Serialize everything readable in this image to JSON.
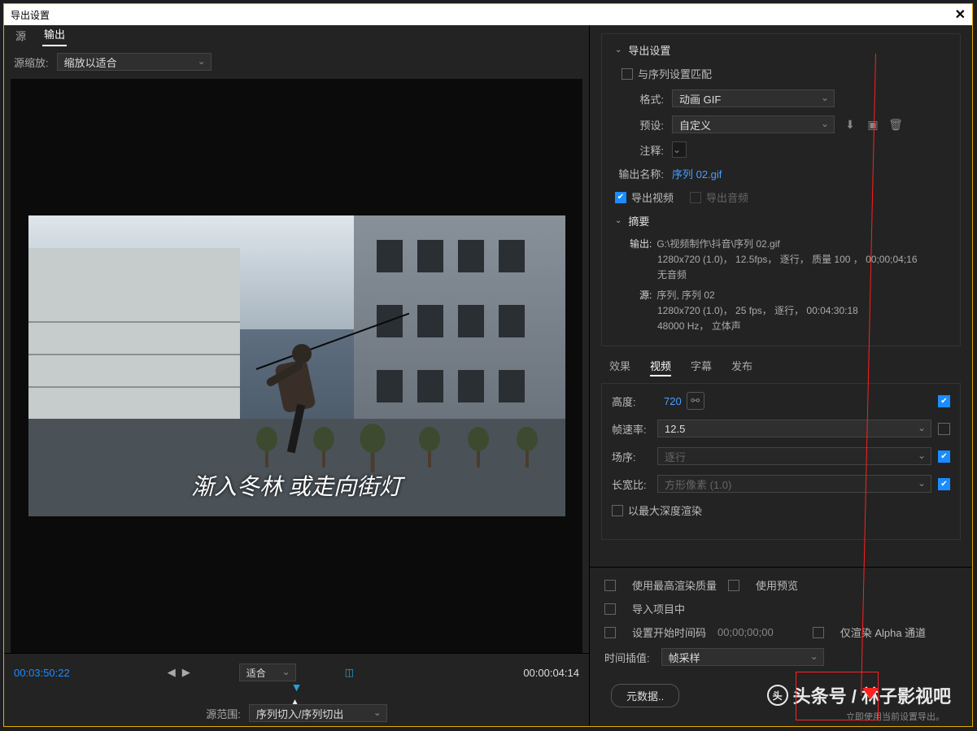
{
  "title": "导出设置",
  "left": {
    "tabs": {
      "source": "源",
      "output": "输出"
    },
    "scale_label": "源缩放:",
    "scale_value": "缩放以适合",
    "subtitle": "渐入冬林  或走向街灯",
    "tc_left": "00:03:50:22",
    "fit": "适合",
    "tc_right": "00:00:04:14",
    "range_label": "源范围:",
    "range_value": "序列切入/序列切出"
  },
  "export": {
    "header": "导出设置",
    "match_label": "与序列设置匹配",
    "format_label": "格式:",
    "format_value": "动画 GIF",
    "preset_label": "预设:",
    "preset_value": "自定义",
    "comment_label": "注释:",
    "outname_label": "输出名称:",
    "outname_value": "序列 02.gif",
    "export_video": "导出视频",
    "export_audio": "导出音频"
  },
  "summary": {
    "header": "摘要",
    "out_lbl": "输出:",
    "out_path": "G:\\视频制作\\抖音\\序列 02.gif",
    "out_line2": "1280x720 (1.0)， 12.5fps， 逐行， 质量 100 ， 00;00;04;16",
    "out_line3": "无音频",
    "src_lbl": "源:",
    "src_line1": "序列, 序列 02",
    "src_line2": "1280x720 (1.0)， 25 fps， 逐行， 00:04:30:18",
    "src_line3": "48000  Hz， 立体声"
  },
  "vtabs": {
    "fx": "效果",
    "video": "视频",
    "caption": "字幕",
    "publish": "发布"
  },
  "video": {
    "height_lbl": "高度:",
    "height_val": "720",
    "fps_lbl": "帧速率:",
    "fps_val": "12.5",
    "order_lbl": "场序:",
    "order_val": "逐行",
    "par_lbl": "长宽比:",
    "par_val": "方形像素 (1.0)",
    "maxdepth": "以最大深度渲染"
  },
  "bottom": {
    "maxq": "使用最高渲染质量",
    "preview": "使用预览",
    "import": "导入项目中",
    "starttc": "设置开始时间码",
    "starttc_val": "00;00;00;00",
    "alpha": "仅渲染 Alpha 通道",
    "interp_lbl": "时间插值:",
    "interp_val": "帧采样"
  },
  "footer": {
    "metadata": "元数据..",
    "hint": "立即使用当前设置导出。"
  },
  "watermark": "头条号 / 林子影视吧"
}
